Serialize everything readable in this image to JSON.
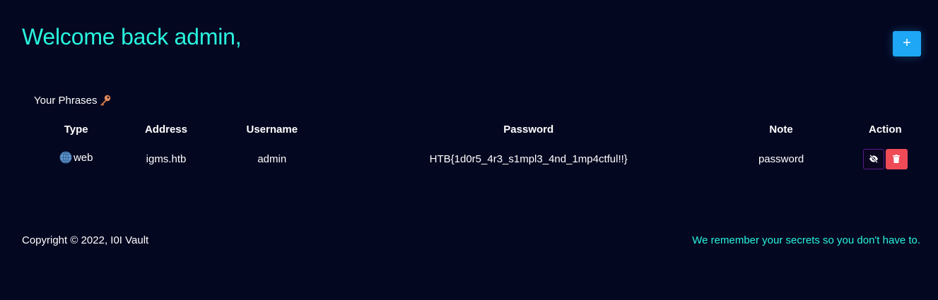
{
  "header": {
    "welcome": "Welcome back admin,",
    "add_label": "+"
  },
  "phrases": {
    "title": "Your Phrases",
    "title_icon": "key-icon",
    "columns": [
      "Type",
      "Address",
      "Username",
      "Password",
      "Note",
      "Action"
    ],
    "rows": [
      {
        "type": "web",
        "type_icon": "globe-icon",
        "address": "igms.htb",
        "username": "admin",
        "password": "HTB{1d0r5_4r3_s1mpl3_4nd_1mp4ctful!!}",
        "note": "password",
        "actions": [
          "eye-slash-icon",
          "trash-icon"
        ]
      }
    ]
  },
  "footer": {
    "copyright": "Copyright © 2022, I0I Vault",
    "tagline": "We remember your secrets so you don't have to."
  },
  "colors": {
    "background": "#040720",
    "accent": "#29f5df",
    "add_button": "#1ea7f5",
    "delete_button": "#ef4b57"
  }
}
